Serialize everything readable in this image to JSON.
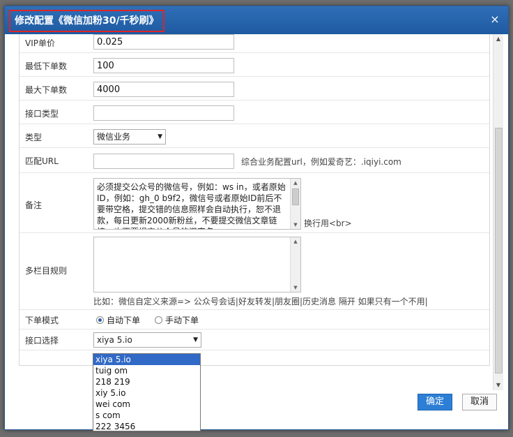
{
  "dialog": {
    "title": "修改配置《微信加粉30/千秒刷》",
    "close_glyph": "×",
    "ok_label": "确定",
    "cancel_label": "取消"
  },
  "form": {
    "vip_price": {
      "label": "VIP单价",
      "value": "0.025"
    },
    "min_order": {
      "label": "最低下单数",
      "value": "100"
    },
    "max_order": {
      "label": "最大下单数",
      "value": "4000"
    },
    "api_type": {
      "label": "接口类型",
      "value": ""
    },
    "type": {
      "label": "类型",
      "value": "微信业务"
    },
    "match_url": {
      "label": "匹配URL",
      "value": "",
      "hint": "综合业务配置url，例如爱奇艺：.iqiyi.com"
    },
    "remark": {
      "label": "备注",
      "text": "必须提交公众号的微信号，例如：ws in，或者原始ID，例如：gh_0 b9f2，微信号或者原始ID前后不要带空格，提交错的信息照样会自动执行，恕不退款，每日更新2000新粉丝，不要提交微信文章链接，也不要提交公众号的汉字名",
      "hint": "换行用<br>"
    },
    "multi_column": {
      "label": "多栏目规则",
      "value": "",
      "hint": "比如：微信自定义来源=> 公众号会话|好友转发|朋友圈|历史消息 隔开 如果只有一个不用|"
    },
    "order_mode": {
      "label": "下单模式",
      "auto": "自动下单",
      "manual": "手动下单",
      "selected": "auto"
    },
    "api_select": {
      "label": "接口选择",
      "value": "xiya 5.io",
      "options": [
        "xiya 5.io",
        "tuig om",
        "218 219",
        "xiy 5.io",
        "wei com",
        "s com",
        "222 3456"
      ]
    }
  }
}
